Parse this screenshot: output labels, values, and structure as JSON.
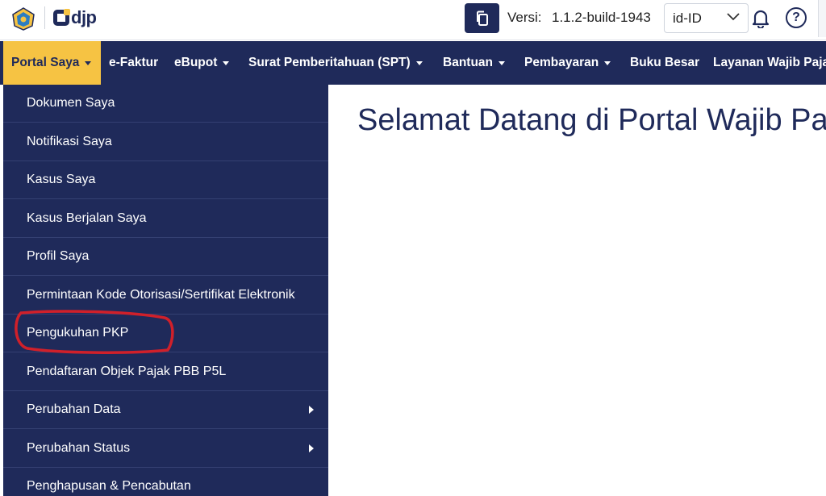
{
  "header": {
    "brand": "djp",
    "version_label": "Versi:",
    "version_value": "1.1.2-build-1943",
    "language": "id-ID",
    "help_glyph": "?"
  },
  "navbar": {
    "items": [
      {
        "label": "Portal Saya",
        "active": true,
        "caret": true
      },
      {
        "label": "e-Faktur",
        "caret": false
      },
      {
        "label": "eBupot",
        "caret": true
      },
      {
        "label": "Surat Pemberitahuan (SPT)",
        "caret": true
      },
      {
        "label": "Bantuan",
        "caret": true
      },
      {
        "label": "Pembayaran",
        "caret": true
      },
      {
        "label": "Buku Besar",
        "caret": false
      },
      {
        "label": "Layanan Wajib Paja",
        "caret": false
      }
    ]
  },
  "dropdown": {
    "items": [
      {
        "label": "Dokumen Saya"
      },
      {
        "label": "Notifikasi Saya"
      },
      {
        "label": "Kasus Saya"
      },
      {
        "label": "Kasus Berjalan Saya"
      },
      {
        "label": "Profil Saya"
      },
      {
        "label": "Permintaan Kode Otorisasi/Sertifikat Elektronik"
      },
      {
        "label": "Pengukuhan PKP",
        "highlighted": true
      },
      {
        "label": "Pendaftaran Objek Pajak PBB P5L"
      },
      {
        "label": "Perubahan Data",
        "submenu": true
      },
      {
        "label": "Perubahan Status",
        "submenu": true
      },
      {
        "label": "Penghapusan & Pencabutan"
      }
    ]
  },
  "main": {
    "welcome_title": "Selamat Datang di Portal Wajib Pa"
  },
  "colors": {
    "navy": "#1f2a5a",
    "accent_yellow": "#f6c343",
    "annotation_red": "#d0202a"
  },
  "icons": {
    "logo": "kemenkeu-emblem",
    "copy": "copy-icon",
    "bell": "bell-icon",
    "help": "help-icon",
    "chevron": "chevron-down-icon"
  }
}
